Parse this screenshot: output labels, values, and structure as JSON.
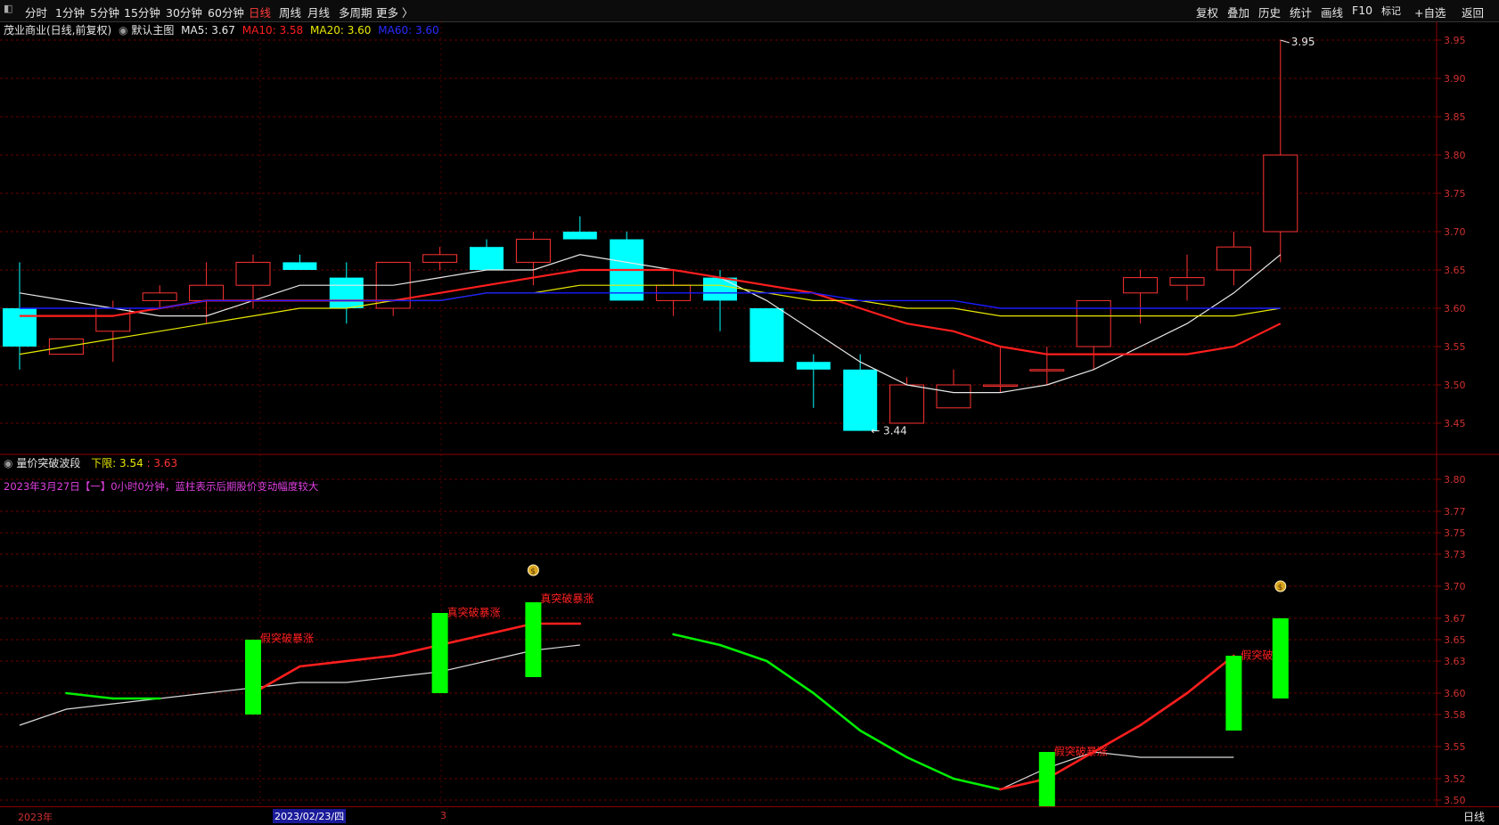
{
  "toolbar": {
    "left_items": [
      {
        "label": "分时",
        "active": false
      },
      {
        "label": "1分钟",
        "active": false
      },
      {
        "label": "5分钟",
        "active": false
      },
      {
        "label": "15分钟",
        "active": false
      },
      {
        "label": "30分钟",
        "active": false
      },
      {
        "label": "60分钟",
        "active": false
      },
      {
        "label": "日线",
        "active": true
      },
      {
        "label": "周线",
        "active": false
      },
      {
        "label": "月线",
        "active": false
      },
      {
        "label": "多周期",
        "active": false
      },
      {
        "label": "更多 〉",
        "active": false
      }
    ],
    "right_items": [
      "复权",
      "叠加",
      "历史",
      "统计",
      "画线",
      "F10",
      "标记",
      "+自选",
      "返回"
    ]
  },
  "main_legend": {
    "stock": "茂业商业(日线,前复权)",
    "template": "默认主图",
    "ma5": "MA5: 3.67",
    "ma10": "MA10: 3.58",
    "ma20": "MA20: 3.60",
    "ma60": "MA60: 3.60"
  },
  "sub_legend": {
    "name": "量价突破波段",
    "lower_label": "下限:",
    "lower_value": "3.54",
    "upper_value": ": 3.63",
    "info": "2023年3月27日【一】0小时0分钟，蓝柱表示后期股价变动幅度较大"
  },
  "bottom": {
    "year_label": "2023年",
    "cursor_date": "2023/02/23/四",
    "marker": "3",
    "period": "日线"
  },
  "colors": {
    "up": "#ff3232",
    "down": "#00ffff",
    "ma5": "#e8e8e8",
    "ma10": "#ff1e1e",
    "ma20": "#e8e800",
    "ma60": "#1a1aff",
    "grid": "#8b0000",
    "signal_bar": "#00ff00"
  },
  "chart_data": [
    {
      "type": "candlestick",
      "ylim": [
        3.41,
        3.97
      ],
      "yticks": [
        3.45,
        3.5,
        3.55,
        3.6,
        3.65,
        3.7,
        3.75,
        3.8,
        3.85,
        3.9,
        3.95
      ],
      "candles": [
        {
          "o": 3.6,
          "h": 3.66,
          "l": 3.52,
          "c": 3.55
        },
        {
          "o": 3.54,
          "h": 3.56,
          "l": 3.54,
          "c": 3.56
        },
        {
          "o": 3.57,
          "h": 3.61,
          "l": 3.53,
          "c": 3.6
        },
        {
          "o": 3.61,
          "h": 3.63,
          "l": 3.6,
          "c": 3.62
        },
        {
          "o": 3.61,
          "h": 3.66,
          "l": 3.58,
          "c": 3.63
        },
        {
          "o": 3.63,
          "h": 3.67,
          "l": 3.6,
          "c": 3.66
        },
        {
          "o": 3.66,
          "h": 3.67,
          "l": 3.65,
          "c": 3.65
        },
        {
          "o": 3.64,
          "h": 3.66,
          "l": 3.58,
          "c": 3.6
        },
        {
          "o": 3.6,
          "h": 3.66,
          "l": 3.59,
          "c": 3.66
        },
        {
          "o": 3.66,
          "h": 3.68,
          "l": 3.65,
          "c": 3.67
        },
        {
          "o": 3.68,
          "h": 3.69,
          "l": 3.65,
          "c": 3.65
        },
        {
          "o": 3.66,
          "h": 3.7,
          "l": 3.63,
          "c": 3.69
        },
        {
          "o": 3.7,
          "h": 3.72,
          "l": 3.69,
          "c": 3.69
        },
        {
          "o": 3.69,
          "h": 3.7,
          "l": 3.61,
          "c": 3.61
        },
        {
          "o": 3.61,
          "h": 3.65,
          "l": 3.59,
          "c": 3.63
        },
        {
          "o": 3.64,
          "h": 3.65,
          "l": 3.57,
          "c": 3.61
        },
        {
          "o": 3.6,
          "h": 3.6,
          "l": 3.53,
          "c": 3.53
        },
        {
          "o": 3.53,
          "h": 3.54,
          "l": 3.47,
          "c": 3.52
        },
        {
          "o": 3.52,
          "h": 3.54,
          "l": 3.44,
          "c": 3.44
        },
        {
          "o": 3.45,
          "h": 3.51,
          "l": 3.45,
          "c": 3.5
        },
        {
          "o": 3.47,
          "h": 3.52,
          "l": 3.47,
          "c": 3.5
        },
        {
          "o": 3.5,
          "h": 3.55,
          "l": 3.49,
          "c": 3.5
        },
        {
          "o": 3.52,
          "h": 3.55,
          "l": 3.5,
          "c": 3.52
        },
        {
          "o": 3.55,
          "h": 3.61,
          "l": 3.52,
          "c": 3.61
        },
        {
          "o": 3.62,
          "h": 3.65,
          "l": 3.58,
          "c": 3.64
        },
        {
          "o": 3.63,
          "h": 3.67,
          "l": 3.61,
          "c": 3.64
        },
        {
          "o": 3.65,
          "h": 3.7,
          "l": 3.63,
          "c": 3.68
        },
        {
          "o": 3.7,
          "h": 3.95,
          "l": 3.66,
          "c": 3.8
        }
      ],
      "series": [
        {
          "name": "MA5",
          "values": [
            3.62,
            3.61,
            3.6,
            3.59,
            3.59,
            3.61,
            3.63,
            3.63,
            3.63,
            3.64,
            3.65,
            3.65,
            3.67,
            3.66,
            3.65,
            3.64,
            3.61,
            3.57,
            3.53,
            3.5,
            3.49,
            3.49,
            3.5,
            3.52,
            3.55,
            3.58,
            3.62,
            3.67
          ]
        },
        {
          "name": "MA10",
          "values": [
            3.59,
            3.59,
            3.59,
            3.6,
            3.61,
            3.61,
            3.61,
            3.61,
            3.61,
            3.62,
            3.63,
            3.64,
            3.65,
            3.65,
            3.65,
            3.64,
            3.63,
            3.62,
            3.6,
            3.58,
            3.57,
            3.55,
            3.54,
            3.54,
            3.54,
            3.54,
            3.55,
            3.58
          ]
        },
        {
          "name": "MA20",
          "values": [
            3.54,
            3.55,
            3.56,
            3.57,
            3.58,
            3.59,
            3.6,
            3.6,
            3.61,
            3.61,
            3.62,
            3.62,
            3.63,
            3.63,
            3.63,
            3.63,
            3.62,
            3.61,
            3.61,
            3.6,
            3.6,
            3.59,
            3.59,
            3.59,
            3.59,
            3.59,
            3.59,
            3.6
          ]
        },
        {
          "name": "MA60",
          "values": [
            3.6,
            3.6,
            3.6,
            3.6,
            3.61,
            3.61,
            3.61,
            3.61,
            3.61,
            3.61,
            3.62,
            3.62,
            3.62,
            3.62,
            3.62,
            3.62,
            3.62,
            3.62,
            3.61,
            3.61,
            3.61,
            3.6,
            3.6,
            3.6,
            3.6,
            3.6,
            3.6,
            3.6
          ]
        }
      ],
      "annotations": [
        {
          "text": "3.95",
          "x_index": 27,
          "y": 3.95
        },
        {
          "text": "3.44",
          "x_index": 18,
          "y": 3.44
        }
      ]
    },
    {
      "type": "line",
      "ylim": [
        3.48,
        3.83
      ],
      "yticks": [
        3.5,
        3.52,
        3.55,
        3.58,
        3.6,
        3.63,
        3.65,
        3.67,
        3.7,
        3.73,
        3.75,
        3.77,
        3.8
      ],
      "base_line": [
        3.57,
        3.585,
        3.59,
        3.595,
        3.6,
        3.605,
        3.61,
        3.61,
        3.615,
        3.62,
        3.63,
        3.64,
        3.645,
        null,
        null,
        null,
        null,
        null,
        null,
        null,
        null,
        3.51,
        3.53,
        3.545,
        3.54,
        3.54,
        3.54,
        null
      ],
      "signal_line": [
        null,
        3.6,
        3.595,
        3.595,
        null,
        3.6,
        3.625,
        3.63,
        3.635,
        3.645,
        3.655,
        3.665,
        3.665,
        null,
        3.655,
        3.645,
        3.63,
        3.6,
        3.565,
        3.54,
        3.52,
        3.51,
        3.52,
        3.545,
        3.57,
        3.6,
        3.635,
        null
      ],
      "signal_colors": [
        null,
        "green",
        "green",
        "green",
        null,
        "red",
        "red",
        "red",
        "red",
        "red",
        "red",
        "red",
        "red",
        null,
        "green",
        "green",
        "green",
        "green",
        "green",
        "green",
        "green",
        "green",
        "red",
        "red",
        "red",
        "red",
        "red",
        null
      ],
      "bars": [
        {
          "x_index": 5,
          "low": 3.58,
          "high": 3.65
        },
        {
          "x_index": 9,
          "low": 3.6,
          "high": 3.675
        },
        {
          "x_index": 11,
          "low": 3.615,
          "high": 3.685
        },
        {
          "x_index": 22,
          "low": 3.475,
          "high": 3.545
        },
        {
          "x_index": 26,
          "low": 3.565,
          "high": 3.635
        },
        {
          "x_index": 27,
          "low": 3.595,
          "high": 3.67
        }
      ],
      "labels": [
        {
          "text": "假突破暴涨",
          "x_index": 5,
          "y": 3.648
        },
        {
          "text": "真突破暴涨",
          "x_index": 9,
          "y": 3.672
        },
        {
          "text": "真突破暴涨",
          "x_index": 11,
          "y": 3.685
        },
        {
          "text": "假突破暴涨",
          "x_index": 22,
          "y": 3.542
        },
        {
          "text": "假突破",
          "x_index": 26,
          "y": 3.632
        }
      ],
      "money_icons": [
        {
          "x_index": 11,
          "y": 3.715
        },
        {
          "x_index": 27,
          "y": 3.7
        }
      ]
    }
  ]
}
